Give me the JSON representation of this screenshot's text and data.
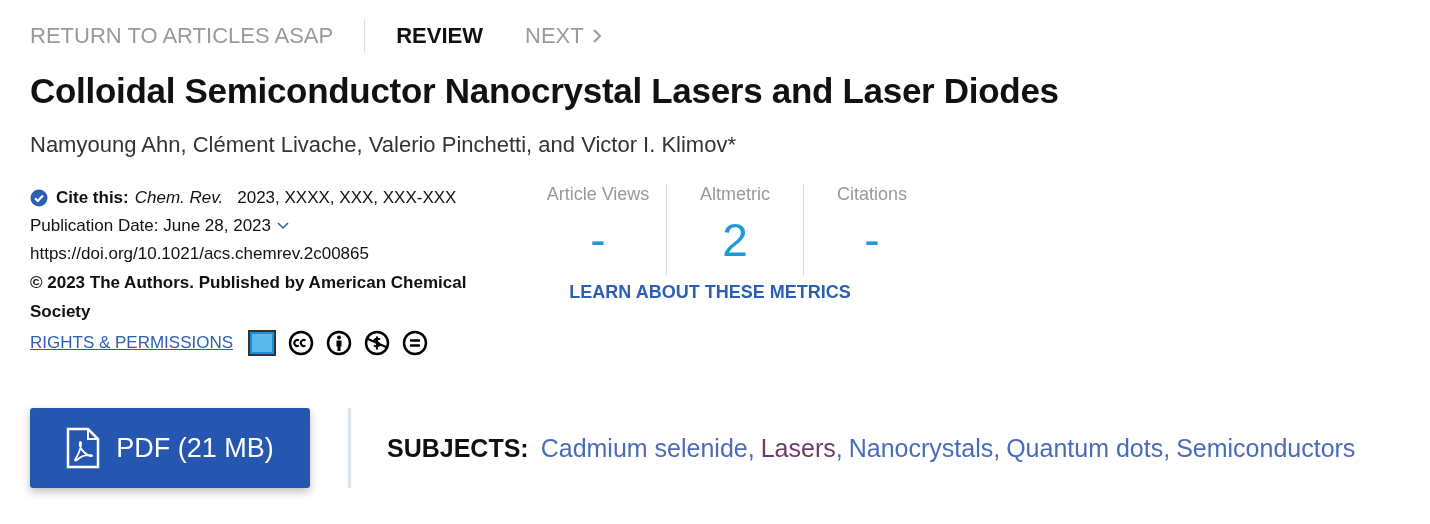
{
  "nav": [
    {
      "kind": "link",
      "label": "RETURN TO ARTICLES ASAP"
    },
    {
      "kind": "type",
      "label": "REVIEW"
    },
    {
      "kind": "next",
      "label": "NEXT"
    }
  ],
  "title": "Colloidal Semiconductor Nanocrystal Lasers and Laser Diodes",
  "authors": "Namyoung Ahn, Clément Livache, Valerio Pinchetti, and Victor I. Klimov*",
  "citation": {
    "label": "Cite this:",
    "journal": "Chem. Rev.",
    "details": "2023, XXXX, XXX, XXX-XXX"
  },
  "publication_date": {
    "text": "Publication Date: June 28, 2023",
    "expanded": false
  },
  "doi": "https://doi.org/10.1021/acs.chemrev.2c00865",
  "copyright": "© 2023 The Authors. Published by American Chemical Society",
  "rights_link": "RIGHTS & PERMISSIONS",
  "metrics": [
    {
      "label": "Article Views",
      "value": "-"
    },
    {
      "label": "Altmetric",
      "value": "2"
    },
    {
      "label": "Citations",
      "value": "-"
    }
  ],
  "metrics_link": "LEARN ABOUT THESE METRICS",
  "pdf_button": "PDF (21 MB)",
  "subjects": {
    "label": "SUBJECTS:",
    "separator": ",",
    "items": [
      {
        "name": "Cadmium selenide",
        "visited": false
      },
      {
        "name": "Lasers",
        "visited": true
      },
      {
        "name": "Nanocrystals",
        "visited": false
      },
      {
        "name": "Quantum dots",
        "visited": false
      },
      {
        "name": "Semiconductors",
        "visited": false
      }
    ]
  }
}
